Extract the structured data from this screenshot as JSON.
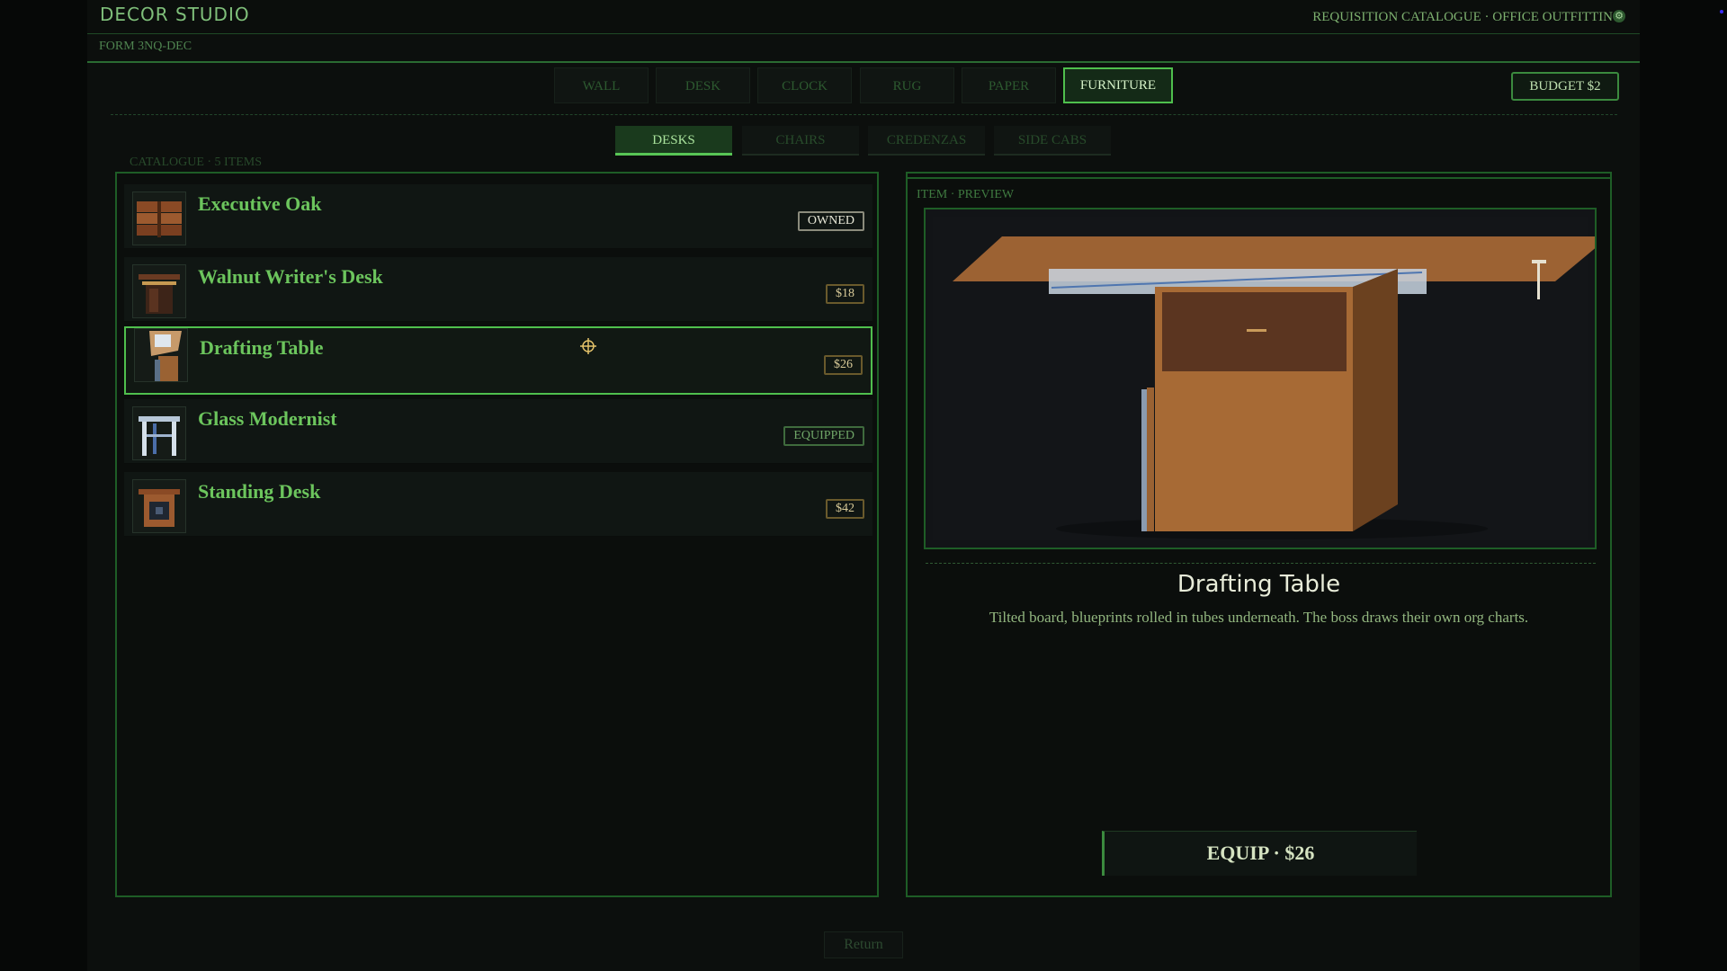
{
  "app": {
    "title": "DECOR STUDIO",
    "header_right": "REQUISITION CATALOGUE · OFFICE OUTFITTIN",
    "form_label": "FORM 3NQ-DEC"
  },
  "tabs": [
    {
      "label": "WALL",
      "active": false
    },
    {
      "label": "DESK",
      "active": false
    },
    {
      "label": "CLOCK",
      "active": false
    },
    {
      "label": "RUG",
      "active": false
    },
    {
      "label": "PAPER",
      "active": false
    },
    {
      "label": "FURNITURE",
      "active": true
    }
  ],
  "budget": "BUDGET $2",
  "subtabs": [
    {
      "label": "DESKS",
      "active": true
    },
    {
      "label": "CHAIRS",
      "active": false
    },
    {
      "label": "CREDENZAS",
      "active": false
    },
    {
      "label": "SIDE CABS",
      "active": false
    }
  ],
  "catalogue": {
    "count_label": "CATALOGUE · 5 ITEMS",
    "items": [
      {
        "name": "Executive Oak",
        "badge": "OWNED",
        "badge_type": "owned",
        "icon": "executive-oak-desk-icon"
      },
      {
        "name": "Walnut Writer's Desk",
        "badge": "$18",
        "badge_type": "price",
        "icon": "walnut-writer-desk-icon"
      },
      {
        "name": "Drafting Table",
        "badge": "$26",
        "badge_type": "price",
        "icon": "drafting-table-icon",
        "selected": true
      },
      {
        "name": "Glass Modernist",
        "badge": "EQUIPPED",
        "badge_type": "equipped",
        "icon": "glass-modernist-desk-icon"
      },
      {
        "name": "Standing Desk",
        "badge": "$42",
        "badge_type": "price",
        "icon": "standing-desk-icon"
      }
    ]
  },
  "preview": {
    "label": "ITEM · PREVIEW",
    "title": "Drafting Table",
    "description": "Tilted board, blueprints rolled in tubes underneath. The boss draws their own org charts.",
    "equip_label": "EQUIP · $26"
  },
  "footer": {
    "return_label": "Return"
  },
  "colors": {
    "accent": "#4fbf4d",
    "text_green": "#6cc55d",
    "background": "#0c0f0d"
  }
}
